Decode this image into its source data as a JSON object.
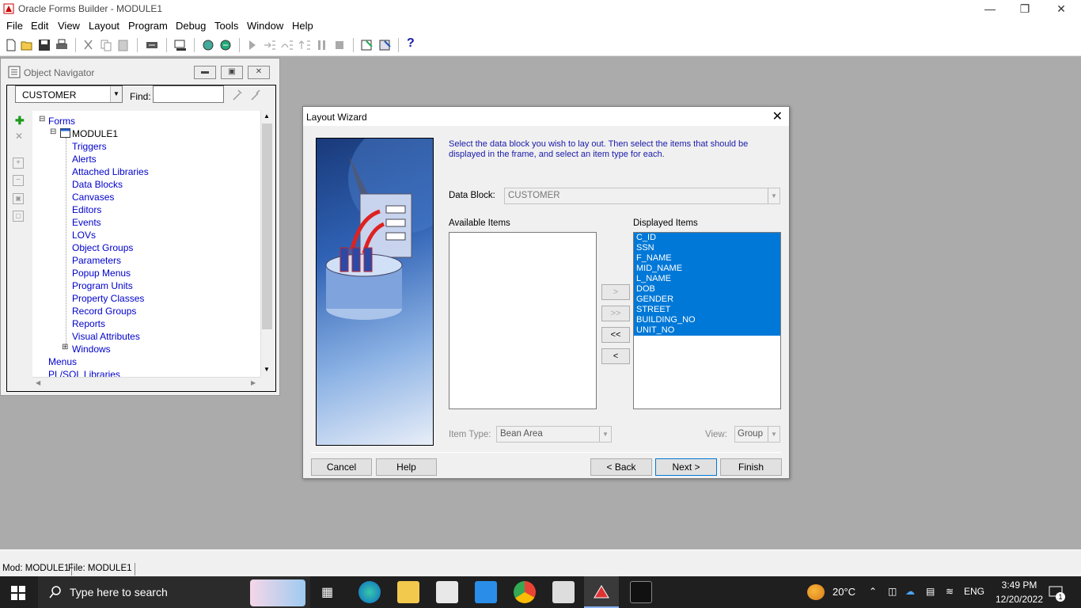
{
  "window": {
    "title": "Oracle Forms Builder - MODULE1"
  },
  "menu": [
    "File",
    "Edit",
    "View",
    "Layout",
    "Program",
    "Debug",
    "Tools",
    "Window",
    "Help"
  ],
  "toolbar": {
    "help_glyph": "?"
  },
  "navigator": {
    "title": "Object Navigator",
    "combo_value": "CUSTOMER",
    "find_label": "Find:",
    "find_value": "",
    "tree": {
      "root": "Forms",
      "module": "MODULE1",
      "children": [
        "Triggers",
        "Alerts",
        "Attached Libraries",
        "Data Blocks",
        "Canvases",
        "Editors",
        "Events",
        "LOVs",
        "Object Groups",
        "Parameters",
        "Popup Menus",
        "Program Units",
        "Property Classes",
        "Record Groups",
        "Reports",
        "Visual Attributes",
        "Windows"
      ],
      "siblings": [
        "Menus",
        "PL/SQL Libraries"
      ]
    }
  },
  "wizard": {
    "title": "Layout Wizard",
    "instructions": "Select the data block you wish to lay out. Then select the items that should be displayed in the frame, and select an item type for each.",
    "data_block_label": "Data Block:",
    "data_block_value": "CUSTOMER",
    "available_label": "Available Items",
    "displayed_label": "Displayed Items",
    "available_items": [],
    "displayed_items": [
      "C_ID",
      "SSN",
      "F_NAME",
      "MID_NAME",
      "L_NAME",
      "DOB",
      "GENDER",
      "STREET",
      "BUILDING_NO",
      "UNIT_NO"
    ],
    "move_buttons": [
      ">",
      ">>",
      "<<",
      "<"
    ],
    "item_type_label": "Item Type:",
    "item_type_value": "Bean Area",
    "view_label": "View:",
    "view_value": "Group",
    "buttons": {
      "cancel": "Cancel",
      "help": "Help",
      "back": "< Back",
      "next": "Next >",
      "finish": "Finish"
    }
  },
  "statusbar": {
    "mod": "Mod: MODULE1",
    "file": "File: MODULE1"
  },
  "taskbar": {
    "search_placeholder": "Type here to search",
    "temperature": "20°C",
    "language": "ENG",
    "time": "3:49 PM",
    "date": "12/20/2022",
    "notification_count": "1"
  },
  "colors": {
    "selection": "#0078d7",
    "tree_link": "#0000cc",
    "instruction_text": "#1a1aaa"
  }
}
